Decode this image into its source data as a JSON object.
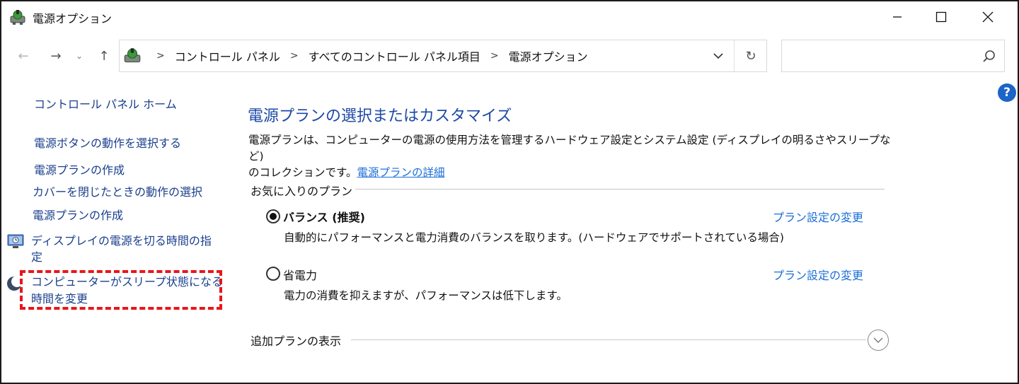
{
  "window": {
    "title": "電源オプション",
    "app_icon": "power-options-icon"
  },
  "nav": {
    "back_glyph": "←",
    "forward_glyph": "→",
    "recent_glyph": "⌄",
    "up_glyph": "↑",
    "refresh_glyph": "↻"
  },
  "address": {
    "breadcrumbs": [
      "コントロール パネル",
      "すべてのコントロール パネル項目",
      "電源オプション"
    ],
    "separator": ">"
  },
  "search": {
    "value": "",
    "placeholder": ""
  },
  "help": {
    "label": "?"
  },
  "sidebar": {
    "home": "コントロール パネル ホーム",
    "items": [
      "電源ボタンの動作を選択する",
      "電源プランの作成",
      "カバーを閉じたときの動作の選択",
      "電源プランの作成",
      "ディスプレイの電源を切る時間の指",
      "定",
      "コンピューターがスリープ状態になる",
      "時間を変更"
    ]
  },
  "main": {
    "title": "電源プランの選択またはカスタマイズ",
    "description_line1": "電源プランは、コンピューターの電源の使用方法を管理するハードウェア設定とシステム設定 (ディスプレイの明るさやスリープなど)",
    "description_line2": "のコレクションです。",
    "description_link": "電源プランの詳細",
    "favorites_heading": "お気に入りのプラン",
    "plans": [
      {
        "name": "バランス (推奨)",
        "description": "自動的にパフォーマンスと電力消費のバランスを取ります。(ハードウェアでサポートされている場合)",
        "link": "プラン設定の変更",
        "selected": true
      },
      {
        "name": "省電力",
        "description": "電力の消費を抑えますが、パフォーマンスは低下します。",
        "link": "プラン設定の変更",
        "selected": false
      }
    ],
    "more_plans_heading": "追加プランの表示"
  },
  "colors": {
    "link": "#1a6ed8",
    "title": "#1d4aa6",
    "nav_link": "#1a3f8c",
    "highlight": "#e8161b",
    "help_bg": "#1c64c8"
  }
}
